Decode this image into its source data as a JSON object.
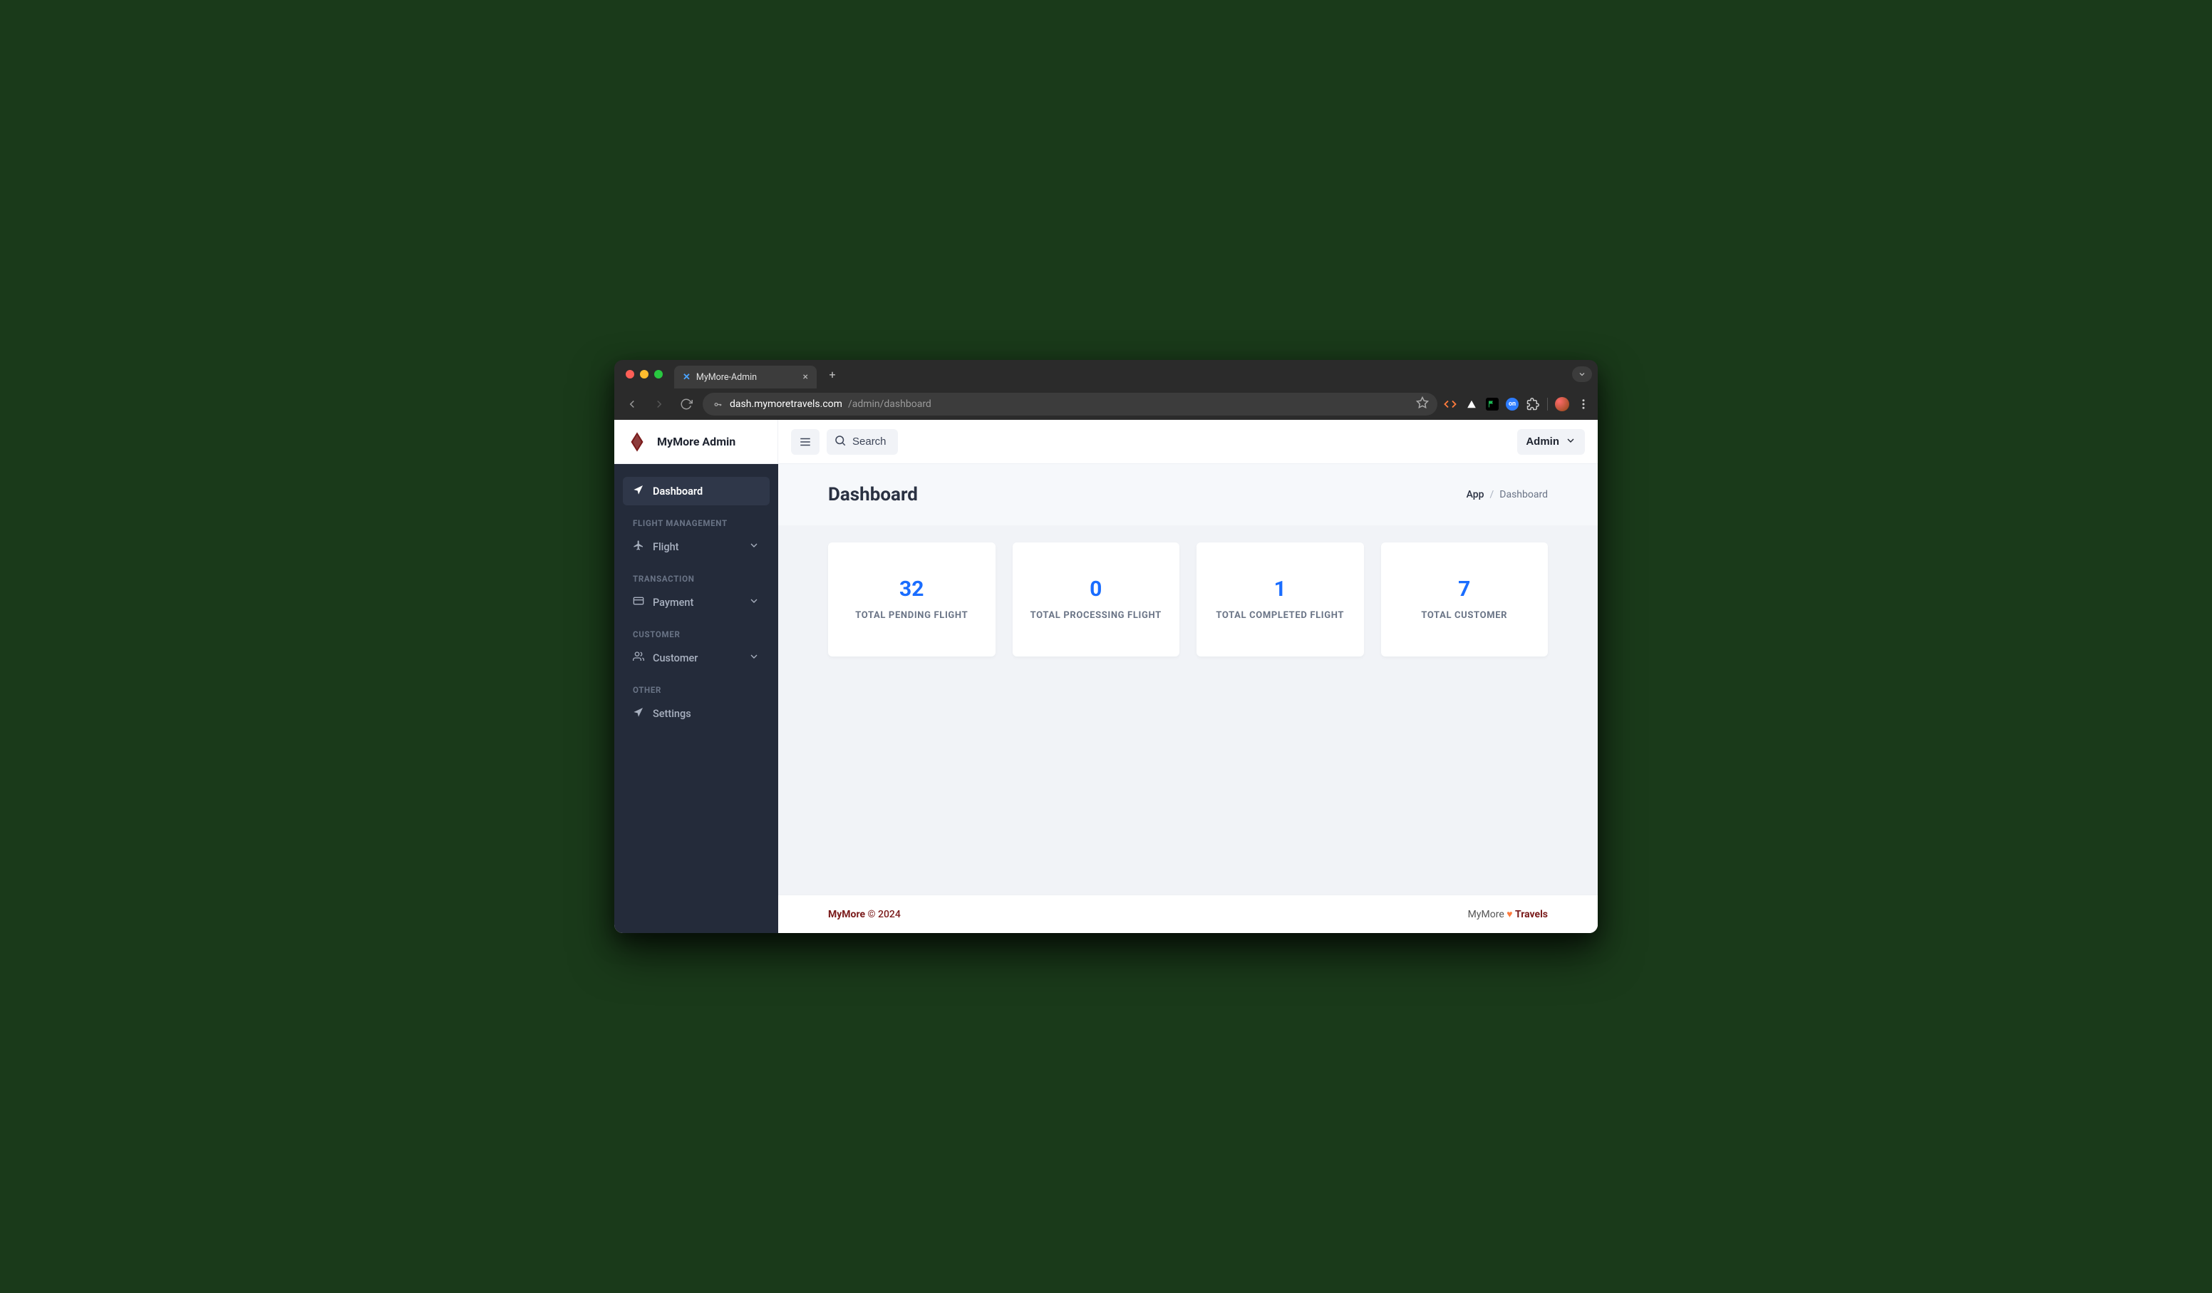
{
  "browser": {
    "tab_title": "MyMore-Admin",
    "url_domain": "dash.mymoretravels.com",
    "url_path": "/admin/dashboard"
  },
  "header": {
    "brand": "MyMore Admin",
    "search_label": "Search",
    "admin_label": "Admin"
  },
  "sidebar": {
    "dashboard": "Dashboard",
    "section_flight": "FLIGHT MANAGEMENT",
    "flight": "Flight",
    "section_transaction": "TRANSACTION",
    "payment": "Payment",
    "section_customer": "CUSTOMER",
    "customer": "Customer",
    "section_other": "OTHER",
    "settings": "Settings"
  },
  "page": {
    "title": "Dashboard",
    "breadcrumb_root": "App",
    "breadcrumb_current": "Dashboard"
  },
  "cards": {
    "pending_value": "32",
    "pending_label": "TOTAL PENDING FLIGHT",
    "processing_value": "0",
    "processing_label": "TOTAL PROCESSING FLIGHT",
    "completed_value": "1",
    "completed_label": "TOTAL COMPLETED FLIGHT",
    "customer_value": "7",
    "customer_label": "TOTAL CUSTOMER"
  },
  "footer": {
    "brand": "MyMore",
    "copyright": "© 2024",
    "right_prefix": "MyMore ",
    "right_suffix": "Travels"
  }
}
